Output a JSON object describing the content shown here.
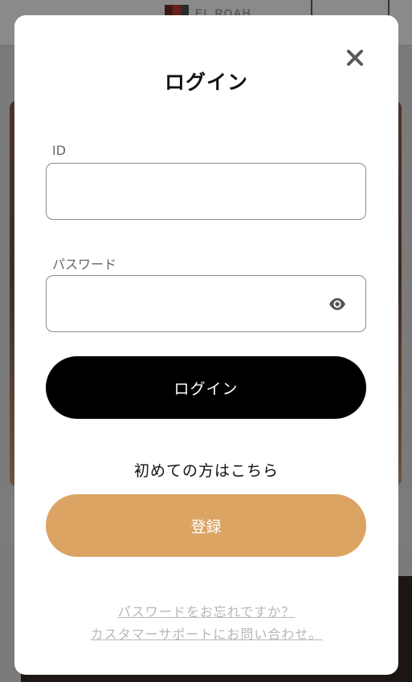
{
  "background": {
    "logo_text": "EL ROAH"
  },
  "modal": {
    "title": "ログイン",
    "close_icon": "close-icon",
    "id_field": {
      "label": "ID",
      "value": "",
      "placeholder": ""
    },
    "password_field": {
      "label": "パスワード",
      "value": "",
      "placeholder": "",
      "toggle_icon": "eye-icon"
    },
    "login_button_label": "ログイン",
    "first_time_text": "初めての方はこちら",
    "register_button_label": "登録",
    "forgot_password_link": "パスワードをお忘れですか？",
    "support_link": "カスタマーサポートにお問い合わせ。"
  },
  "colors": {
    "primary_button": "#000000",
    "register_button": "#dba462",
    "link_text": "#b7b7b7",
    "overlay": "#7a7a7a"
  }
}
